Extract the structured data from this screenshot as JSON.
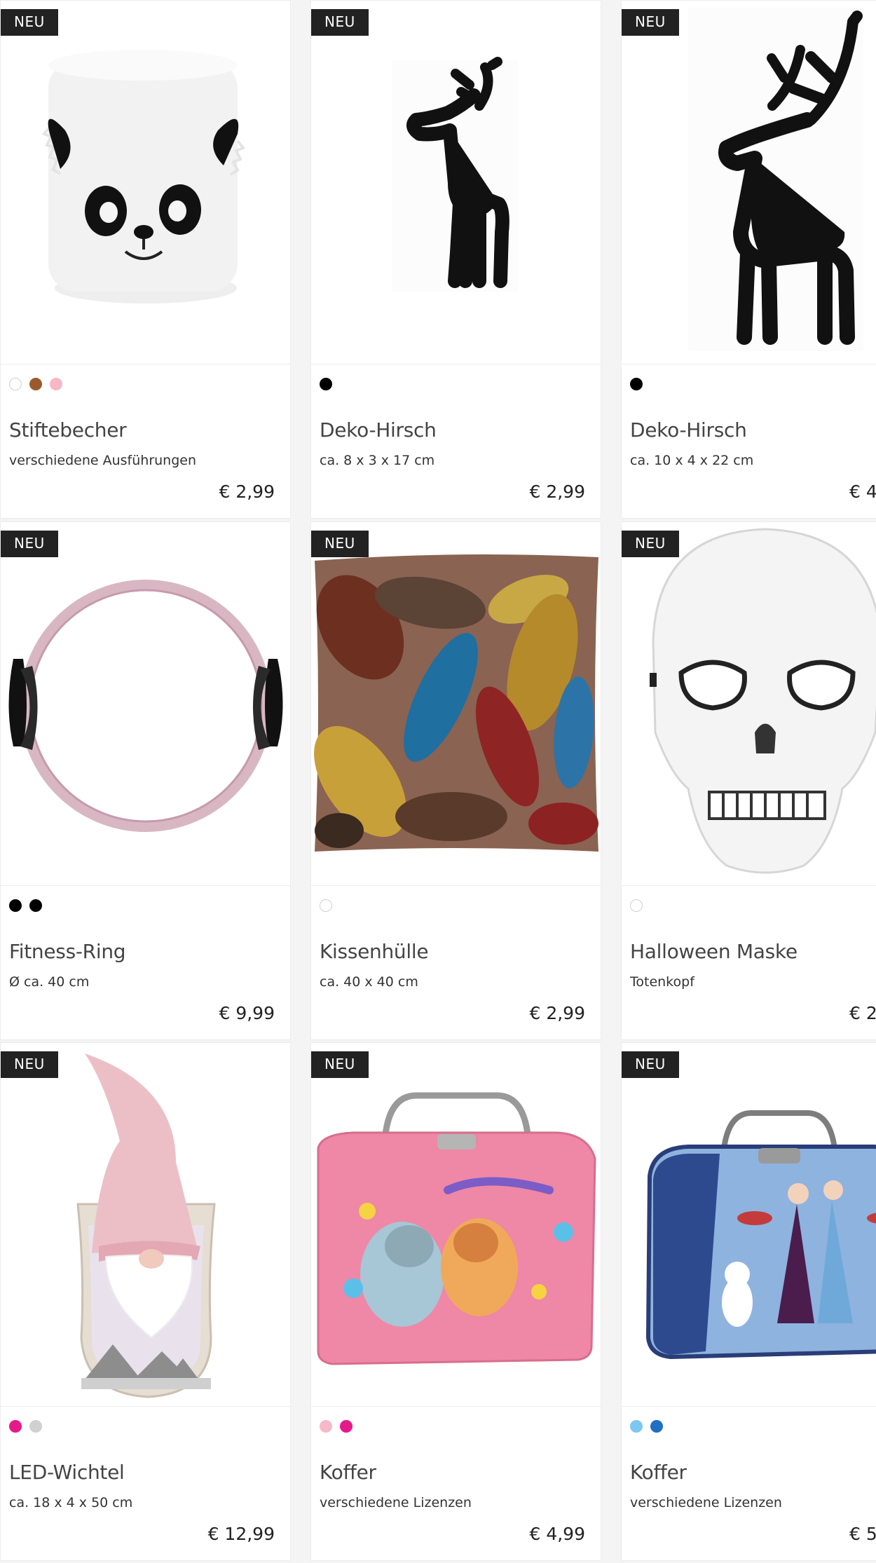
{
  "products": [
    {
      "badge": "NEU",
      "title": "Stiftebecher",
      "desc": "verschiedene Ausführungen",
      "price": "€ 2,99",
      "swatches": [
        "#ffffff",
        "#9b5a2e",
        "#f6b8c6"
      ],
      "image": "panda-pen-holder"
    },
    {
      "badge": "NEU",
      "title": "Deko-Hirsch",
      "desc": "ca. 8 x 3 x 17 cm",
      "price": "€ 2,99",
      "swatches": [
        "#000000"
      ],
      "image": "black-deer-small"
    },
    {
      "badge": "NEU",
      "title": "Deko-Hirsch",
      "desc": "ca. 10 x 4 x 22 cm",
      "price": "€ 4,",
      "swatches": [
        "#000000"
      ],
      "image": "black-deer-large"
    },
    {
      "badge": "NEU",
      "title": "Fitness-Ring",
      "desc": "Ø ca. 40 cm",
      "price": "€ 9,99",
      "swatches": [
        "#000000",
        "#000000"
      ],
      "image": "pilates-ring"
    },
    {
      "badge": "NEU",
      "title": "Kissenhülle",
      "desc": "ca. 40 x 40 cm",
      "price": "€ 2,99",
      "swatches": [
        "#ffffff"
      ],
      "image": "leaf-cushion"
    },
    {
      "badge": "NEU",
      "title": "Halloween Maske",
      "desc": "Totenkopf",
      "price": "€ 2,",
      "swatches": [
        "#ffffff"
      ],
      "image": "skull-mask"
    },
    {
      "badge": "NEU",
      "title": "LED-Wichtel",
      "desc": "ca. 18 x 4 x 50 cm",
      "price": "€ 12,99",
      "swatches": [
        "#e6198a",
        "#d0d0d0"
      ],
      "image": "gnome-led"
    },
    {
      "badge": "NEU",
      "title": "Koffer",
      "desc": "verschiedene Lizenzen",
      "price": "€ 4,99",
      "swatches": [
        "#f7b8c8",
        "#e6198a"
      ],
      "image": "pink-suitcase"
    },
    {
      "badge": "NEU",
      "title": "Koffer",
      "desc": "verschiedene Lizenzen",
      "price": "€ 5,",
      "swatches": [
        "#7ec8f0",
        "#1f6fc4"
      ],
      "image": "blue-suitcase"
    }
  ]
}
